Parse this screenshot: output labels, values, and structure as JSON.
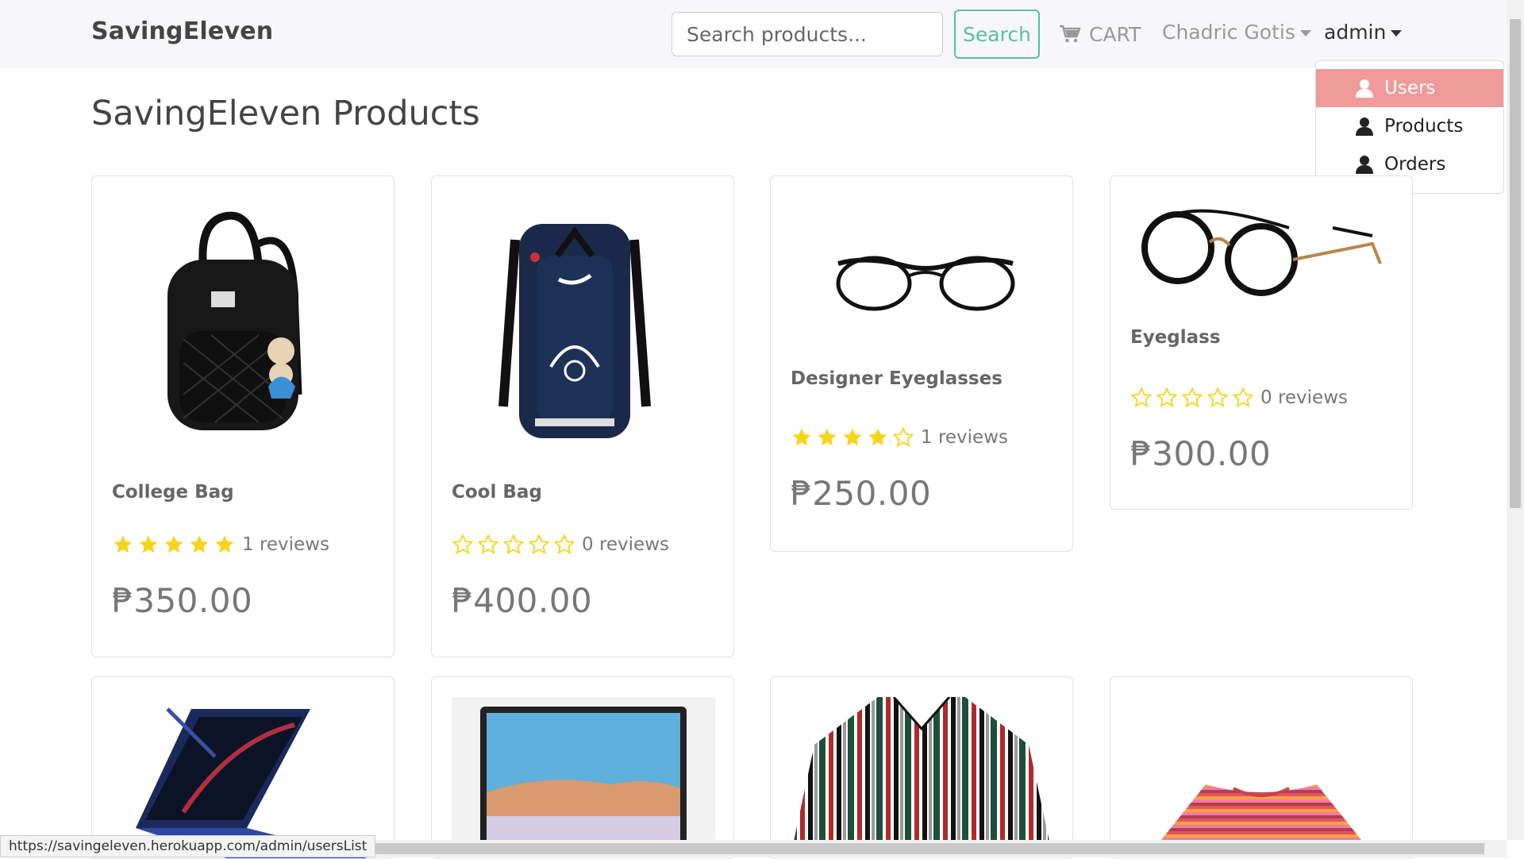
{
  "nav": {
    "brand": "SavingEleven",
    "search_placeholder": "Search products...",
    "search_button": "Search",
    "cart_label": "CART",
    "user_name": "Chadric Gotis",
    "admin_label": "admin"
  },
  "admin_dropdown": {
    "items": [
      {
        "label": "Users",
        "active": true
      },
      {
        "label": "Products",
        "active": false
      },
      {
        "label": "Orders",
        "active": false
      }
    ]
  },
  "page_title": "SavingEleven Products",
  "products": [
    {
      "name": "College Bag",
      "rating": 5,
      "reviews": "1 reviews",
      "price": "₱350.00",
      "image": "black-backpack"
    },
    {
      "name": "Cool Bag",
      "rating": 0,
      "reviews": "0 reviews",
      "price": "₱400.00",
      "image": "navy-nike-backpack"
    },
    {
      "name": "Designer Eyeglasses",
      "rating": 4,
      "reviews": "1 reviews",
      "price": "₱250.00",
      "image": "black-eyeglasses"
    },
    {
      "name": "Eyeglass",
      "rating": 0,
      "reviews": "0 reviews",
      "price": "₱300.00",
      "image": "round-eyeglasses"
    },
    {
      "name": "",
      "image": "laptop"
    },
    {
      "name": "",
      "image": "tablet"
    },
    {
      "name": "",
      "image": "striped-shirt"
    },
    {
      "name": "",
      "image": "striped-tshirt"
    }
  ],
  "status_bar": {
    "url": "https://savingeleven.herokuapp.com/admin/usersList"
  },
  "colors": {
    "accent_green": "#56c29e",
    "dropdown_active": "#f09a9a",
    "star_yellow": "#f7d51d"
  }
}
